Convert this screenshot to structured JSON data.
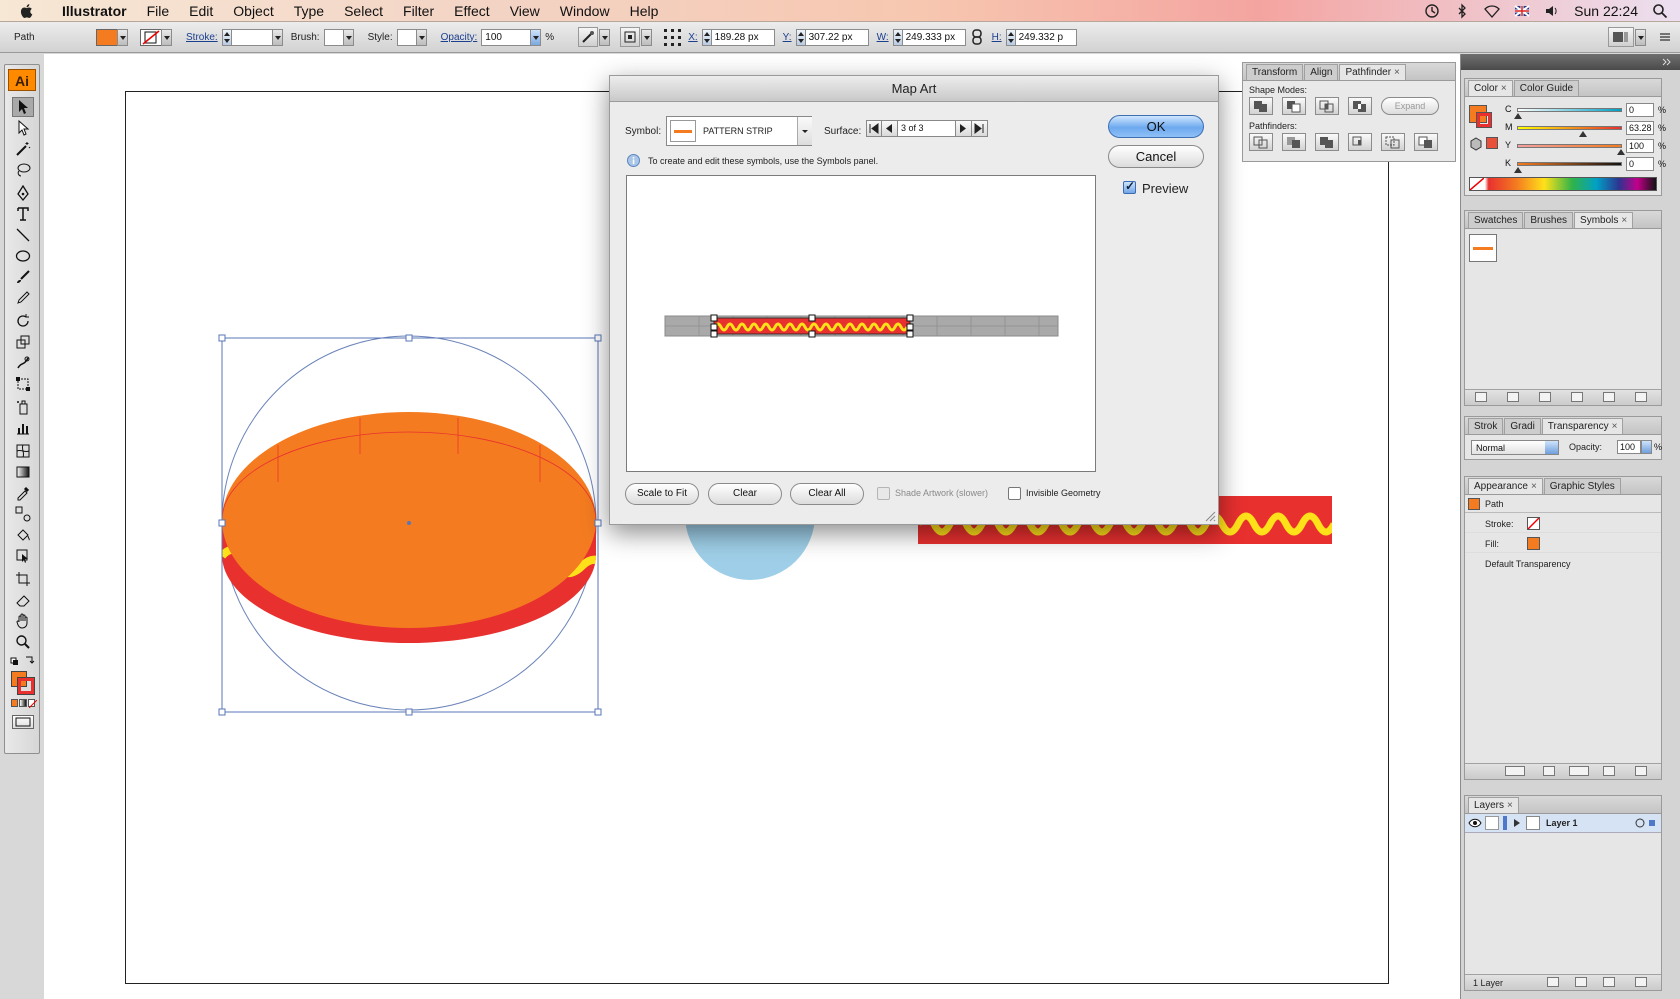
{
  "menubar": {
    "app": "Illustrator",
    "items": [
      "File",
      "Edit",
      "Object",
      "Type",
      "Select",
      "Filter",
      "Effect",
      "View",
      "Window",
      "Help"
    ],
    "clock": "Sun 22:24"
  },
  "control": {
    "selection_type": "Path",
    "stroke_label": "Stroke:",
    "brush_label": "Brush:",
    "style_label": "Style:",
    "opacity_label": "Opacity:",
    "opacity_value": "100",
    "opacity_unit": "%",
    "x_label": "X:",
    "x_value": "189.28 px",
    "y_label": "Y:",
    "y_value": "307.22 px",
    "w_label": "W:",
    "w_value": "249.333 px",
    "h_label": "H:",
    "h_value": "249.332 p",
    "fill_color": "#f47b20"
  },
  "tools": {
    "logo": "Ai",
    "fill_color": "#f47b20",
    "stroke_color": "#e8302f"
  },
  "dialog": {
    "title": "Map Art",
    "symbol_label": "Symbol:",
    "symbol_name": "PATTERN STRIP",
    "surface_label": "Surface:",
    "surface_value": "3 of 3",
    "info": "To create and edit these symbols, use the Symbols panel.",
    "ok": "OK",
    "cancel": "Cancel",
    "preview_label": "Preview",
    "preview_checked": true,
    "scale_to_fit": "Scale to Fit",
    "clear": "Clear",
    "clear_all": "Clear All",
    "shade_artwork": "Shade Artwork (slower)",
    "invisible_geometry": "Invisible Geometry"
  },
  "pathfinder_panel": {
    "tabs": [
      "Transform",
      "Align",
      "Pathfinder"
    ],
    "shape_modes": "Shape Modes:",
    "expand": "Expand",
    "pathfinders": "Pathfinders:"
  },
  "color_panel": {
    "tabs": [
      "Color",
      "Color Guide"
    ],
    "channels": [
      {
        "name": "C",
        "value": "0",
        "color_from": "#ffffff",
        "color_to": "#00a0c6"
      },
      {
        "name": "M",
        "value": "63.28",
        "color_from": "#ffff00",
        "color_to": "#e8302f"
      },
      {
        "name": "Y",
        "value": "100",
        "color_from": "#f4a0a0",
        "color_to": "#f47b20"
      },
      {
        "name": "K",
        "value": "0",
        "color_from": "#f47b20",
        "color_to": "#111111"
      }
    ],
    "pct": "%",
    "fill_color": "#f47b20"
  },
  "symbols_panel": {
    "tabs": [
      "Swatches",
      "Brushes",
      "Symbols"
    ]
  },
  "transparency_panel": {
    "tabs": [
      "Strok",
      "Gradi",
      "Transparency"
    ],
    "blend_mode": "Normal",
    "opacity_label": "Opacity:",
    "opacity_value": "100",
    "pct": "%"
  },
  "appearance_panel": {
    "tabs": [
      "Appearance",
      "Graphic Styles"
    ],
    "object": "Path",
    "stroke_label": "Stroke:",
    "fill_label": "Fill:",
    "default_transparency": "Default Transparency",
    "fill_color": "#f47b20"
  },
  "layers_panel": {
    "tabs": [
      "Layers"
    ],
    "layer_name": "Layer 1",
    "count": "1 Layer"
  },
  "artwork": {
    "orange": "#f47b20",
    "red": "#e8302f",
    "yellow": "#ffe11a",
    "light_blue": "#9fcfe8"
  }
}
